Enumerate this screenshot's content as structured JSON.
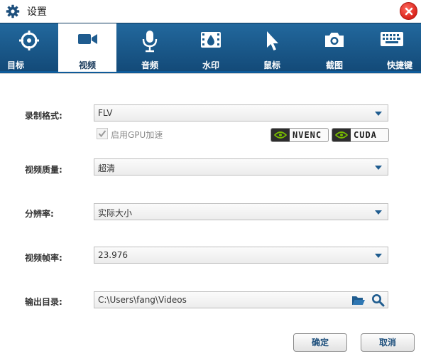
{
  "window": {
    "title": "设置"
  },
  "tabs": [
    {
      "label": "目标",
      "icon": "target-icon",
      "active": false
    },
    {
      "label": "视频",
      "icon": "video-camera-icon",
      "active": true
    },
    {
      "label": "音频",
      "icon": "microphone-icon",
      "active": false
    },
    {
      "label": "水印",
      "icon": "watermark-film-icon",
      "active": false
    },
    {
      "label": "鼠标",
      "icon": "cursor-icon",
      "active": false
    },
    {
      "label": "截图",
      "icon": "camera-icon",
      "active": false
    },
    {
      "label": "快捷键",
      "icon": "keyboard-icon",
      "active": false
    }
  ],
  "form": {
    "record_format": {
      "label": "录制格式:",
      "value": "FLV"
    },
    "gpu": {
      "label": "启用GPU加速",
      "checked": true,
      "enabled": false
    },
    "badges": {
      "nvenc": "NVENC",
      "cuda": "CUDA"
    },
    "quality": {
      "label": "视频质量:",
      "value": "超清"
    },
    "resolution": {
      "label": "分辨率:",
      "value": "实际大小"
    },
    "framerate": {
      "label": "视频帧率:",
      "value": "23.976"
    },
    "output": {
      "label": "输出目录:",
      "value": "C:\\Users\\fang\\Videos"
    }
  },
  "buttons": {
    "ok": "确定",
    "cancel": "取消"
  },
  "colors": {
    "tabbar": "#1a5a8c",
    "accent": "#1f5c8f",
    "close": "#e0261d"
  }
}
